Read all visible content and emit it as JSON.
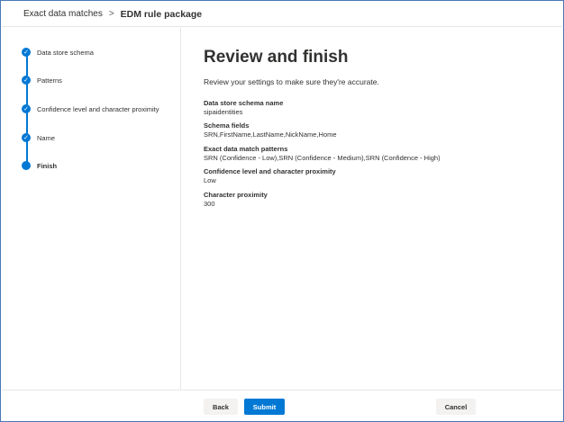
{
  "breadcrumb": {
    "parent": "Exact data matches",
    "separator": ">",
    "current": "EDM rule package"
  },
  "steps": [
    {
      "label": "Data store schema",
      "status": "completed"
    },
    {
      "label": "Patterns",
      "status": "completed"
    },
    {
      "label": "Confidence level and character proximity",
      "status": "completed"
    },
    {
      "label": "Name",
      "status": "completed"
    },
    {
      "label": "Finish",
      "status": "current"
    }
  ],
  "main": {
    "title": "Review and finish",
    "subtitle": "Review your settings to make sure they're accurate.",
    "fields": [
      {
        "label": "Data store schema name",
        "value": "sipaidentities"
      },
      {
        "label": "Schema fields",
        "value": "SRN,FirstName,LastName,NickName,Home"
      },
      {
        "label": "Exact data match patterns",
        "value": "SRN (Confidence - Low),SRN (Confidence - Medium),SRN (Confidence - High)"
      },
      {
        "label": "Confidence level and character proximity",
        "value": "Low"
      },
      {
        "label": "Character proximity",
        "value": "300"
      }
    ]
  },
  "footer": {
    "back_label": "Back",
    "submit_label": "Submit",
    "cancel_label": "Cancel"
  },
  "colors": {
    "accent": "#0078d4",
    "frame_border": "#4a78b8"
  },
  "icons": {
    "completed_step": "checkmark-icon",
    "current_step": "dot-icon"
  }
}
